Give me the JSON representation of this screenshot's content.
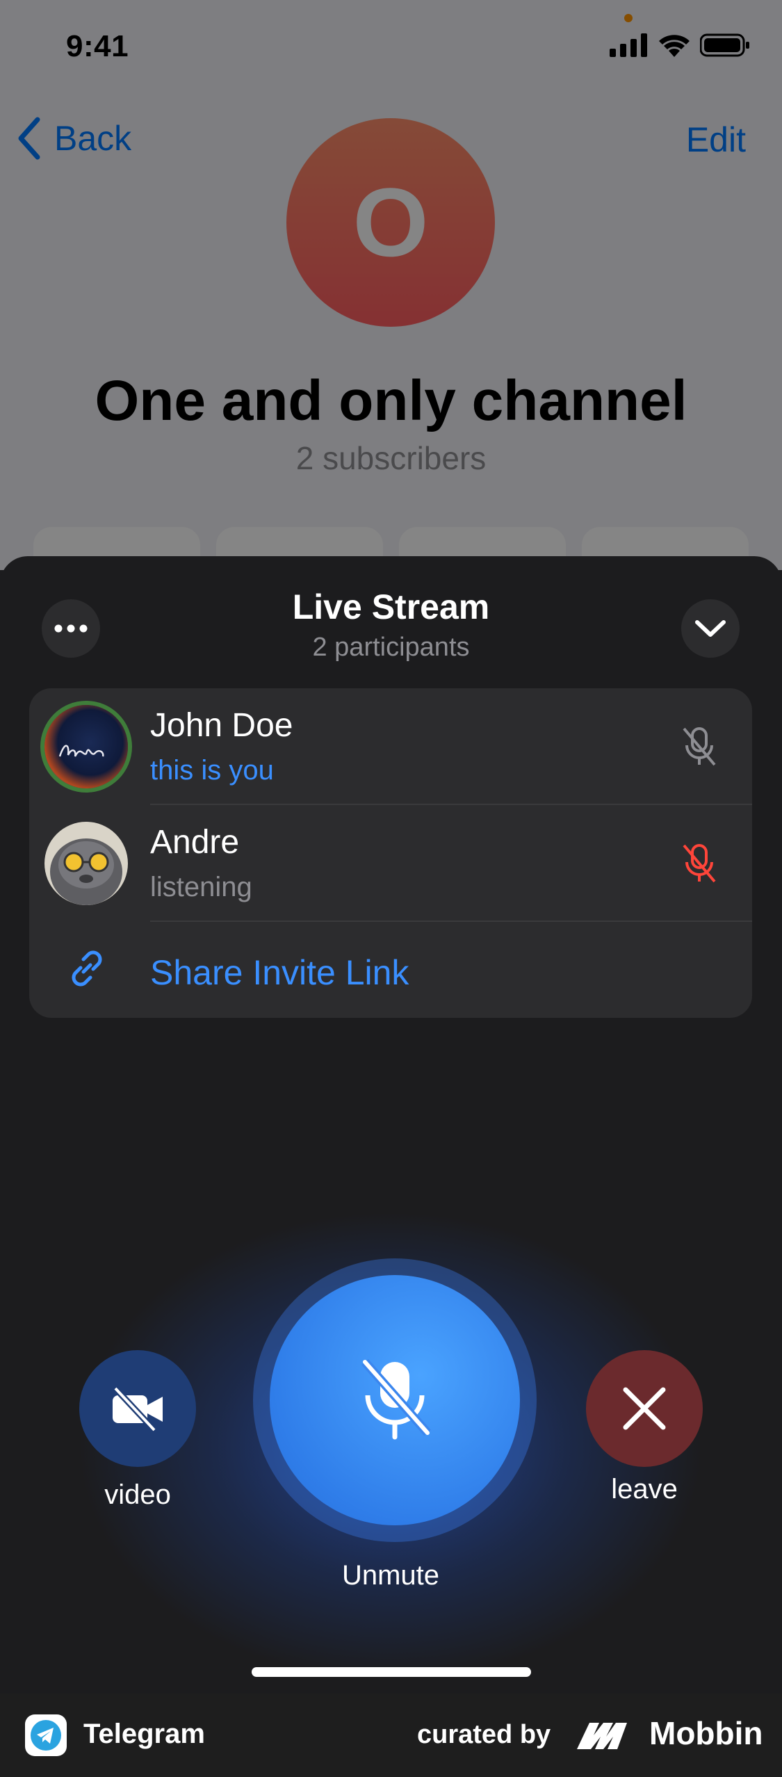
{
  "status_bar": {
    "time": "9:41"
  },
  "channel_page": {
    "back_label": "Back",
    "edit_label": "Edit",
    "avatar_letter": "O",
    "title": "One and only channel",
    "subtitle": "2 subscribers"
  },
  "live_stream": {
    "title": "Live Stream",
    "subtitle": "2 participants",
    "participants": [
      {
        "name": "John Doe",
        "status": "this is you",
        "status_color": "#3a8fff",
        "mic": "muted-gray"
      },
      {
        "name": "Andre",
        "status": "listening",
        "status_color": "#8e8e93",
        "mic": "muted-red"
      }
    ],
    "share_link_label": "Share Invite Link",
    "controls": {
      "video_label": "video",
      "unmute_label": "Unmute",
      "leave_label": "leave"
    }
  },
  "footer": {
    "app_name": "Telegram",
    "curated_by": "curated by",
    "brand": "Mobbin"
  },
  "colors": {
    "accent": "#3a8fff",
    "muted_red": "#ff453a",
    "sheet_bg": "#1c1c1e",
    "card_bg": "#2c2c2e"
  }
}
